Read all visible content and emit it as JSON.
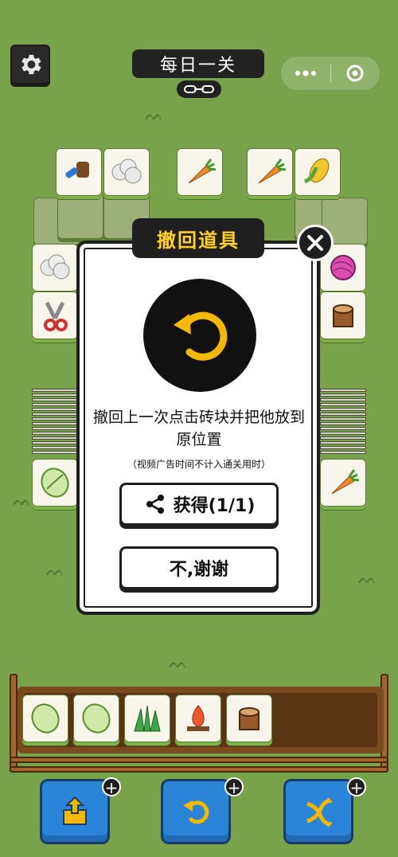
{
  "header": {
    "title": "每日一关",
    "menu_icon": "more-dots-icon",
    "close_icon": "target-circle-icon"
  },
  "dialog": {
    "title": "撤回道具",
    "description": "撤回上一次点击砖块并把他放到原位置",
    "note": "（视频广告时间不计入通关用时）",
    "get_button_label": "获得(1/1)",
    "decline_button_label": "不,谢谢",
    "icon": "undo-arrow-icon"
  },
  "board": {
    "tiles_top_row": [
      "brush",
      "wool",
      "carrot",
      "carrot",
      "corn"
    ],
    "left_column": [
      "brush",
      "wool",
      "scissors",
      "cabbage"
    ],
    "right_column": [
      "yarn",
      "stump",
      "carrot"
    ]
  },
  "tray": {
    "slots": [
      "cabbage",
      "cabbage",
      "grass",
      "campfire",
      "stump"
    ],
    "capacity": 7
  },
  "tools": [
    {
      "name": "move-out",
      "icon": "box-arrow-icon",
      "badge": "+"
    },
    {
      "name": "undo",
      "icon": "undo-icon",
      "badge": "+"
    },
    {
      "name": "shuffle",
      "icon": "shuffle-icon",
      "badge": "+"
    }
  ],
  "colors": {
    "background": "#78a34b",
    "accent_yellow": "#ffd21f",
    "tool_blue": "#2a85d8",
    "tray_wood": "#7b4a1f"
  }
}
